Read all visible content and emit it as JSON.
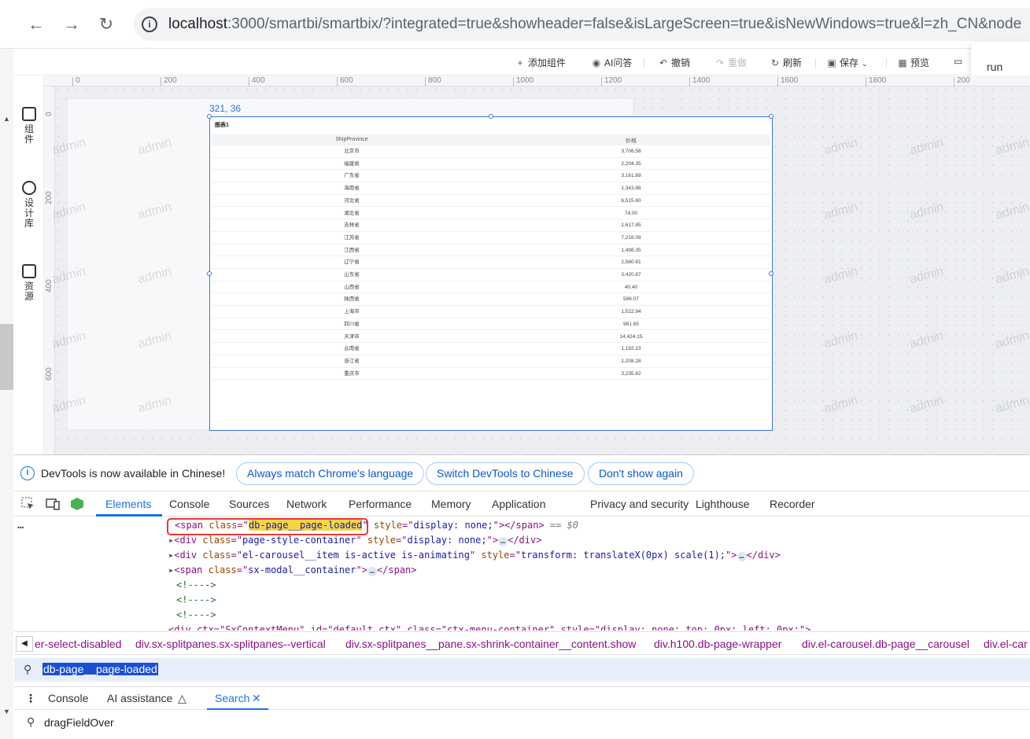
{
  "browser": {
    "url_host": "localhost",
    "url_rest": ":3000/smartbi/smartbix/?integrated=true&showheader=false&isLargeScreen=true&isNewWindows=true&l=zh_CN&node"
  },
  "toolbar": {
    "add_component": "添加组件",
    "ai_qa": "AI问答",
    "undo": "撤销",
    "redo": "重做",
    "refresh": "刷新",
    "save": "保存",
    "preview": "预览"
  },
  "run_popup": {
    "label": "run"
  },
  "left_nav": [
    {
      "label": "组件"
    },
    {
      "label": "设计库"
    },
    {
      "label": "资源"
    }
  ],
  "rulers": {
    "h_ticks": [
      "0",
      "200",
      "400",
      "600",
      "800",
      "1000",
      "1200",
      "1400",
      "1600",
      "1800",
      "200"
    ],
    "v_ticks": [
      "0",
      "200",
      "400",
      "600"
    ]
  },
  "watermark_text": "admin",
  "canvas": {
    "coord_label": "321, 36",
    "widget_title": "图表1",
    "table": {
      "columns": [
        "ShipProvince",
        "价格"
      ],
      "rows": [
        [
          "北京市",
          "3,706.58"
        ],
        [
          "福建省",
          "2,204.35"
        ],
        [
          "广东省",
          "3,161.89"
        ],
        [
          "海南省",
          "1,343.88"
        ],
        [
          "河北省",
          "6,515.60"
        ],
        [
          "湖北省",
          "74.00"
        ],
        [
          "吉林省",
          "1,617.85"
        ],
        [
          "江苏省",
          "7,216.09"
        ],
        [
          "江西省",
          "1,498.35"
        ],
        [
          "辽宁省",
          "2,560.81"
        ],
        [
          "山东省",
          "3,420.87"
        ],
        [
          "山西省",
          "40.40"
        ],
        [
          "陕西省",
          "586.07"
        ],
        [
          "上海市",
          "1,522.94"
        ],
        [
          "四川省",
          "961.65"
        ],
        [
          "天津市",
          "14,424.15"
        ],
        [
          "云南省",
          "1,192.23"
        ],
        [
          "浙江省",
          "1,208.28"
        ],
        [
          "重庆市",
          "3,235.82"
        ]
      ]
    }
  },
  "devtools": {
    "info_text": "DevTools is now available in Chinese!",
    "btn_match": "Always match Chrome's language",
    "btn_switch": "Switch DevTools to Chinese",
    "btn_dismiss": "Don't show again",
    "tabs": [
      "Elements",
      "Console",
      "Sources",
      "Network",
      "Performance",
      "Memory",
      "Application",
      "Privacy and security",
      "Lighthouse",
      "Recorder"
    ],
    "dom": {
      "l1_class": "db-page__page-loaded",
      "l1_style": "display: none;",
      "l1_ref": "== $0",
      "l2_class": "page-style-container",
      "l2_style": "display: none;",
      "l3_class": "el-carousel__item is-active is-animating",
      "l3_style": "transform: translateX(0px) scale(1);",
      "l4_class": "sx-modal__container",
      "comment": "<!---->",
      "l8_partial": "<div ctx=\"SxContextMenu\" id=\"default_ctx\" class=\"ctx-menu-container\" style=\"display: none; top: 0px; left: 0px;\">"
    },
    "breadcrumbs": [
      "er-select-disabled",
      "div.sx-splitpanes.sx-splitpanes--vertical",
      "div.sx-splitpanes__pane.sx-shrink-container__content.show",
      "div.h100.db-page-wrapper",
      "div.el-carousel.db-page__carousel",
      "div.el-car"
    ],
    "search_query": "db-page__page-loaded",
    "drawer_tabs": [
      "Console",
      "AI assistance",
      "Search"
    ],
    "search_input_value": "dragFieldOver",
    "ellipsis": "…",
    "gutter_dots": "…"
  }
}
